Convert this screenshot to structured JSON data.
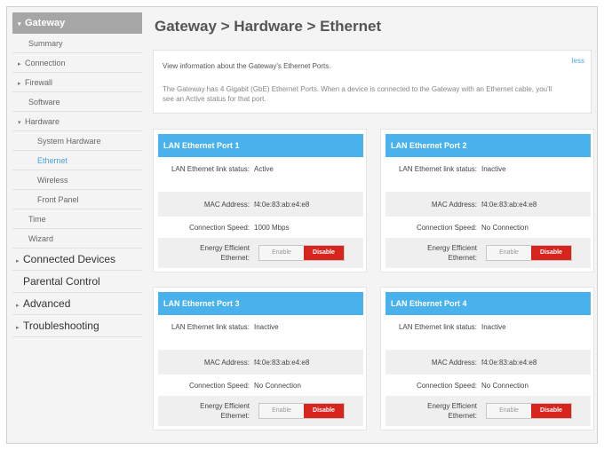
{
  "sidebar": {
    "gateway": "Gateway",
    "summary": "Summary",
    "connection": "Connection",
    "firewall": "Firewall",
    "software": "Software",
    "hardware": "Hardware",
    "system_hardware": "System Hardware",
    "ethernet": "Ethernet",
    "wireless": "Wireless",
    "front_panel": "Front Panel",
    "time": "Time",
    "wizard": "Wizard",
    "connected_devices": "Connected Devices",
    "parental_control": "Parental Control",
    "advanced": "Advanced",
    "troubleshooting": "Troubleshooting"
  },
  "page": {
    "title": "Gateway > Hardware > Ethernet"
  },
  "info": {
    "heading": "View information about the Gateway's Ethernet Ports.",
    "text": "The Gateway has 4 Gigabit (GbE) Ethernet Ports. When a device is connected to the Gateway with an Ethernet cable, you'll see an Active status for that port.",
    "less": "less"
  },
  "labels": {
    "link_status": "LAN Ethernet link status:",
    "mac": "MAC Address:",
    "speed": "Connection Speed:",
    "eee": "Energy Efficient Ethernet:",
    "enable": "Enable",
    "disable": "Disable"
  },
  "ports": [
    {
      "title": "LAN Ethernet Port 1",
      "status": "Active",
      "mac": "f4:0e:83:ab:e4:e8",
      "speed": "1000 Mbps"
    },
    {
      "title": "LAN Ethernet Port 2",
      "status": "Inactive",
      "mac": "f4:0e:83:ab:e4:e8",
      "speed": "No Connection"
    },
    {
      "title": "LAN Ethernet Port 3",
      "status": "Inactive",
      "mac": "f4:0e:83:ab:e4:e8",
      "speed": "No Connection"
    },
    {
      "title": "LAN Ethernet Port 4",
      "status": "Inactive",
      "mac": "f4:0e:83:ab:e4:e8",
      "speed": "No Connection"
    }
  ],
  "colors": {
    "accent": "#49b1ec",
    "danger": "#d9231d",
    "selected": "#4aa3e0"
  }
}
